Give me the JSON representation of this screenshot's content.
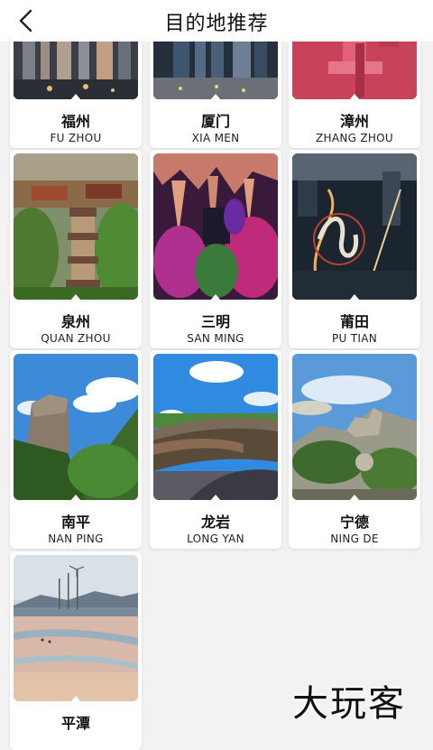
{
  "header": {
    "title": "目的地推荐",
    "back_icon": "chevron-left-icon"
  },
  "destinations": [
    {
      "cn": "福州",
      "en": "FU ZHOU"
    },
    {
      "cn": "厦门",
      "en": "XIA MEN"
    },
    {
      "cn": "漳州",
      "en": "ZHANG ZHOU"
    },
    {
      "cn": "泉州",
      "en": "QUAN ZHOU"
    },
    {
      "cn": "三明",
      "en": "SAN MING"
    },
    {
      "cn": "莆田",
      "en": "PU TIAN"
    },
    {
      "cn": "南平",
      "en": "NAN PING"
    },
    {
      "cn": "龙岩",
      "en": "LONG YAN"
    },
    {
      "cn": "宁德",
      "en": "NING DE"
    },
    {
      "cn": "平潭",
      "en": ""
    }
  ],
  "watermark": "大玩客"
}
